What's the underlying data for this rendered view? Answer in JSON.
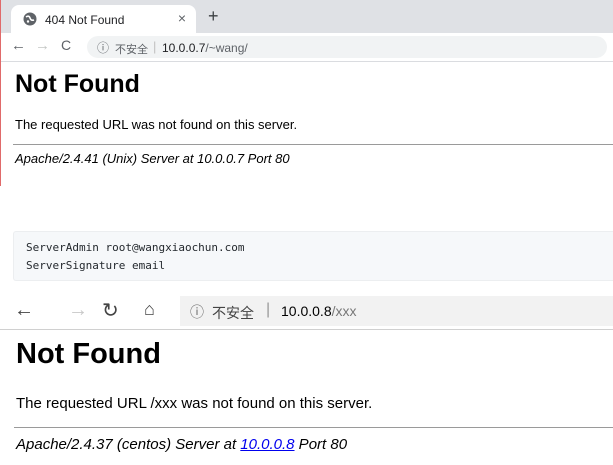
{
  "chrome": {
    "tab": {
      "title": "404 Not Found",
      "close": "×",
      "favicon": "globe-icon"
    },
    "new_tab": "+",
    "nav": {
      "back": "←",
      "forward": "→",
      "reload": "C"
    },
    "omnibox": {
      "info_icon": "ⓘ",
      "security_label": "不安全",
      "separator": "|",
      "host": "10.0.0.7",
      "path": "/~wang/"
    },
    "page": {
      "title": "Not Found",
      "message": "The requested URL was not found on this server.",
      "address": "Apache/2.4.41 (Unix) Server at 10.0.0.7 Port 80"
    }
  },
  "config": {
    "lines": [
      "ServerAdmin root@wangxiaochun.com",
      "ServerSignature email"
    ]
  },
  "edge": {
    "nav": {
      "back": "←",
      "forward": "→",
      "refresh": "↻",
      "home": "⌂"
    },
    "address": {
      "info_icon": "ⓘ",
      "security_label": "不安全",
      "separator": "|",
      "host": "10.0.0.8",
      "path": "/xxx"
    },
    "page": {
      "title": "Not Found",
      "message": "The requested URL /xxx was not found on this server.",
      "address_prefix": "Apache/2.4.37 (centos) Server at ",
      "address_link": "10.0.0.8",
      "address_suffix": " Port 80"
    }
  }
}
